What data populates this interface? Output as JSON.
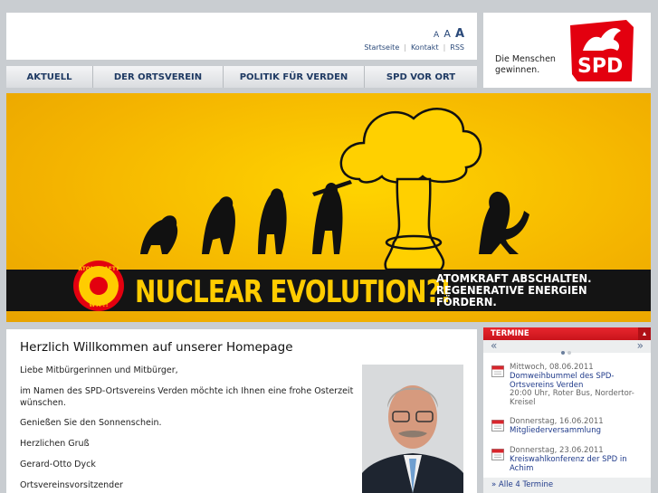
{
  "header": {
    "font_sizes": [
      "A",
      "A",
      "A"
    ],
    "meta_links": [
      "Startseite",
      "Kontakt",
      "RSS"
    ],
    "slogan": "Die Menschen\ngewinnen.",
    "logo_text": "SPD"
  },
  "nav": {
    "items": [
      "AKTUELL",
      "DER ORTSVEREIN",
      "POLITIK FÜR VERDEN",
      "SPD VOR ORT"
    ]
  },
  "banner": {
    "title": "NUCLEAR EVOLUTION?!",
    "tagline": "ATOMKRAFT ABSCHALTEN.\nREGENERATIVE ENERGIEN\nFÖRDERN.",
    "badge_top": "ATOMKRAFT?",
    "badge_bottom": "WTF?!"
  },
  "content": {
    "title": "Herzlich Willkommen auf unserer Homepage",
    "paragraphs": [
      "Liebe Mitbürgerinnen und Mitbürger,",
      "im Namen des SPD-Ortsvereins Verden möchte ich Ihnen eine frohe Osterzeit wünschen.",
      "Genießen Sie den Sonnenschein.",
      "Herzlichen Gruß",
      "Gerard-Otto Dyck",
      "Ortsvereinsvorsitzender"
    ]
  },
  "termine": {
    "header": "TERMINE",
    "close_label": "▴",
    "prev": "«",
    "next": "»",
    "events": [
      {
        "date": "Mittwoch, 08.06.2011",
        "title": "Domweihbummel des SPD-Ortsvereins Verden",
        "detail": "20:00 Uhr,  Roter Bus, Nordertor-Kreisel"
      },
      {
        "date": "Donnerstag, 16.06.2011",
        "title": "Mitgliederversammlung",
        "detail": ""
      },
      {
        "date": "Donnerstag, 23.06.2011",
        "title": "Kreiswahlkonferenz der SPD in Achim",
        "detail": ""
      }
    ],
    "all_link": "»  Alle 4 Termine"
  },
  "colors": {
    "spd_red": "#e3000f",
    "link_blue": "#1f3a8a",
    "banner_yellow": "#ffcc00"
  }
}
